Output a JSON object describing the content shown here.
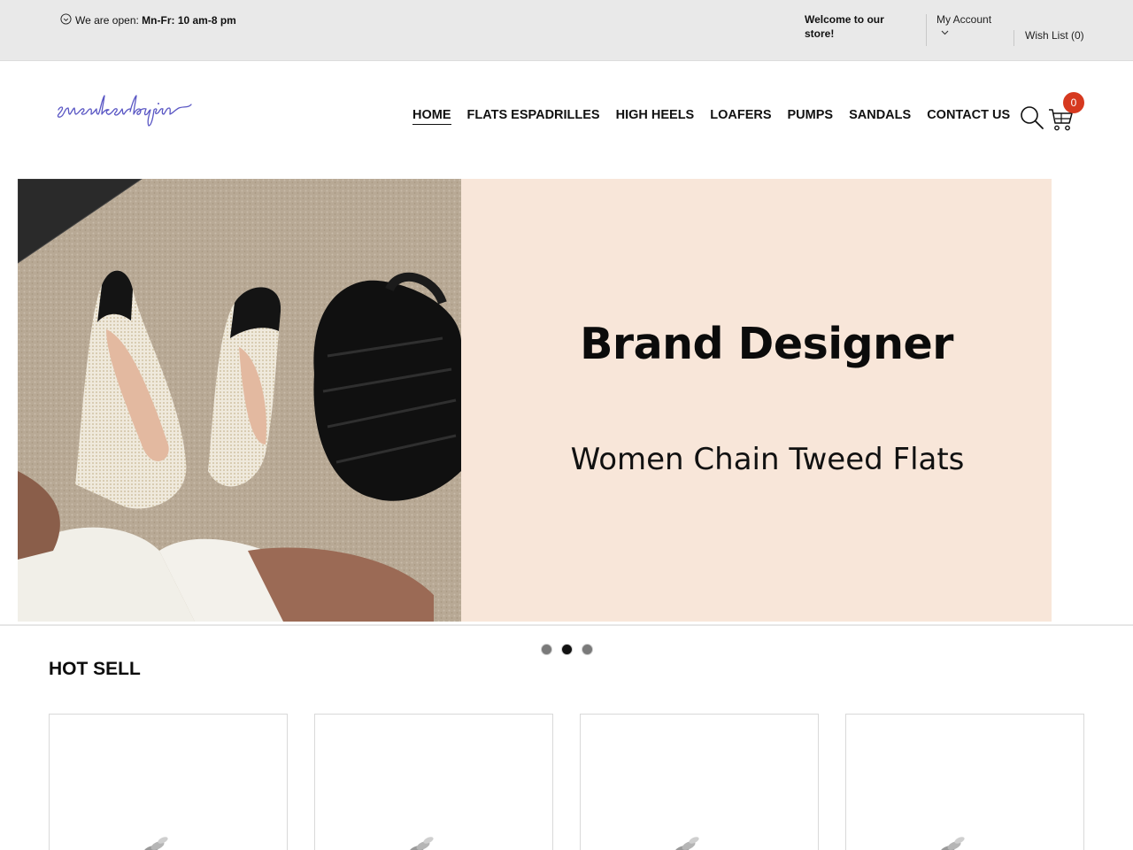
{
  "topbar": {
    "hours_prefix": "We are open:",
    "hours_value": "Mn-Fr: 10 am-8 pm",
    "welcome": "Welcome to our store!",
    "account_label": "My Account",
    "wishlist_label": "Wish List (0)"
  },
  "header": {
    "logo_text": "sneakerlogin",
    "nav": [
      "HOME",
      "FLATS ESPADRILLES",
      "HIGH HEELS",
      "LOAFERS",
      "PUMPS",
      "SANDALS",
      "CONTACT US"
    ],
    "active_nav": "HOME",
    "cart_count": "0"
  },
  "hero": {
    "title": "Brand Designer",
    "subtitle": "Women Chain Tweed Flats",
    "slides": 3,
    "active_slide": 2
  },
  "hot_sell": {
    "title": "HOT SELL",
    "cards": 4
  },
  "colors": {
    "topbar_bg": "#e9e9e9",
    "hero_panel": "#f8e6d9",
    "cart_badge": "#d6391f",
    "logo": "#5a57c4"
  },
  "icons": [
    "clock-icon",
    "chevron-down-icon",
    "search-icon",
    "cart-icon",
    "loading-spinner-icon"
  ]
}
